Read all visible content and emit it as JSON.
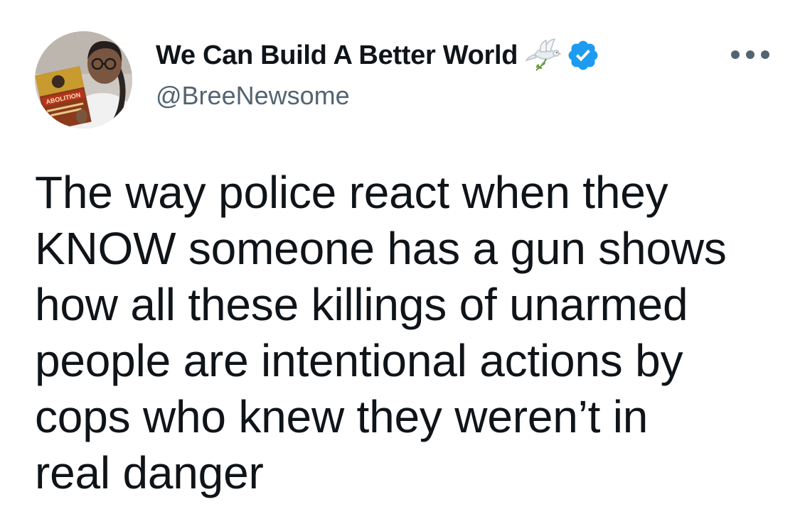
{
  "tweet": {
    "author": {
      "display_name": "We Can Build A Better World",
      "handle": "@BreeNewsome",
      "avatar_book_text": "ABOLITION",
      "name_emoji_icon": "dove-with-olive-branch-icon",
      "verified_icon": "verified-badge-icon",
      "verified_color": "#1d9bf0"
    },
    "menu_icon": "more-options-icon",
    "text_lines": [
      "The way police react when they",
      "KNOW someone has a gun shows",
      "how all these killings of unarmed",
      "people are intentional actions by",
      "cops who knew they weren’t in",
      "real danger"
    ]
  },
  "colors": {
    "text_primary": "#0f1419",
    "text_secondary": "#536471",
    "background": "#ffffff"
  }
}
